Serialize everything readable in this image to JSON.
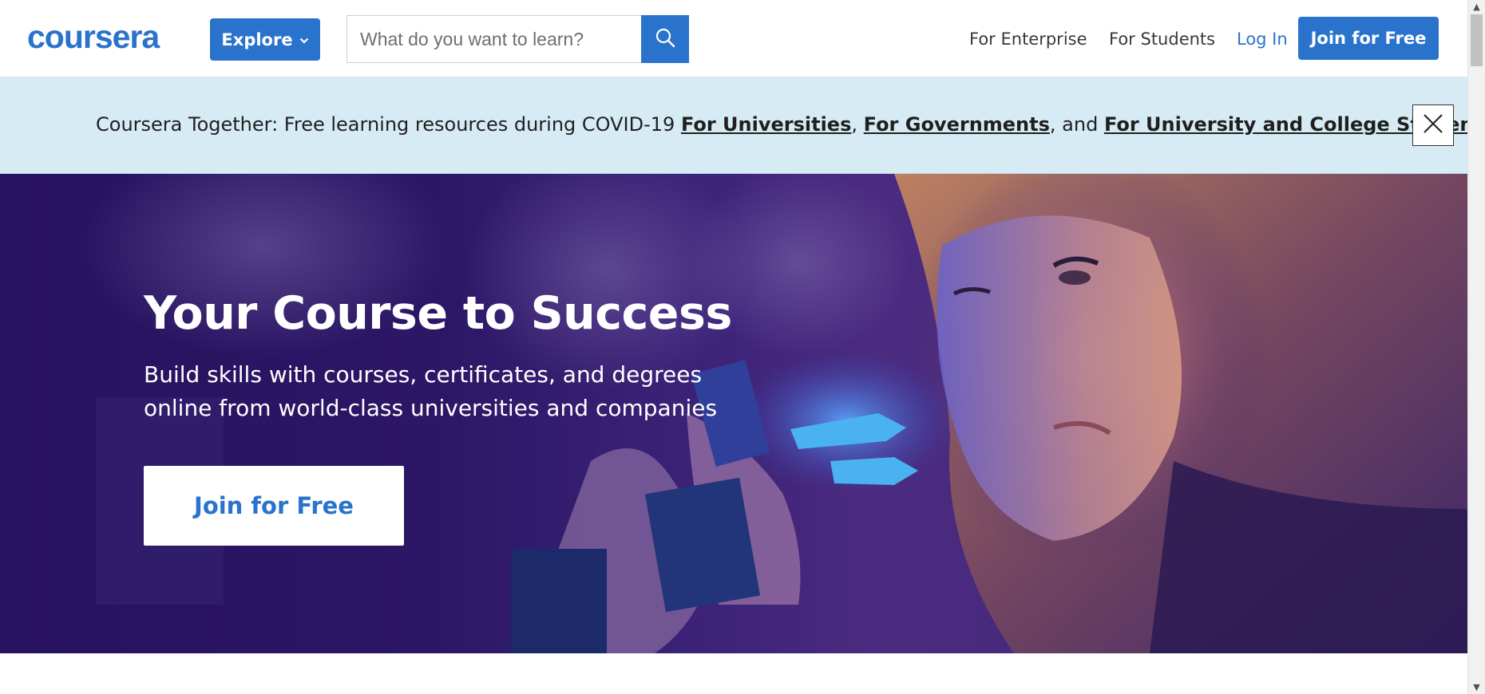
{
  "header": {
    "logo_text": "coursera",
    "explore_label": "Explore",
    "search_placeholder": "What do you want to learn?",
    "nav": {
      "enterprise": "For Enterprise",
      "students": "For Students",
      "login": "Log In"
    },
    "join_label": "Join for Free"
  },
  "banner": {
    "prefix": "Coursera Together: Free learning resources during COVID-19 ",
    "link_universities": "For Universities",
    "sep1": ", ",
    "link_governments": "For Governments",
    "sep2": ", and ",
    "link_students": "For University and College Students"
  },
  "hero": {
    "title": "Your Course to Success",
    "subtitle_line1": "Build skills with courses, certificates, and degrees",
    "subtitle_line2": "online from world-class universities and companies",
    "cta_label": "Join for Free"
  },
  "colors": {
    "brand_blue": "#2a73cc",
    "banner_bg": "#d7ebf5",
    "hero_purple": "#2c1766"
  },
  "icons": {
    "search": "search-icon",
    "close": "close-icon",
    "chevron": "chevron-down-icon"
  }
}
